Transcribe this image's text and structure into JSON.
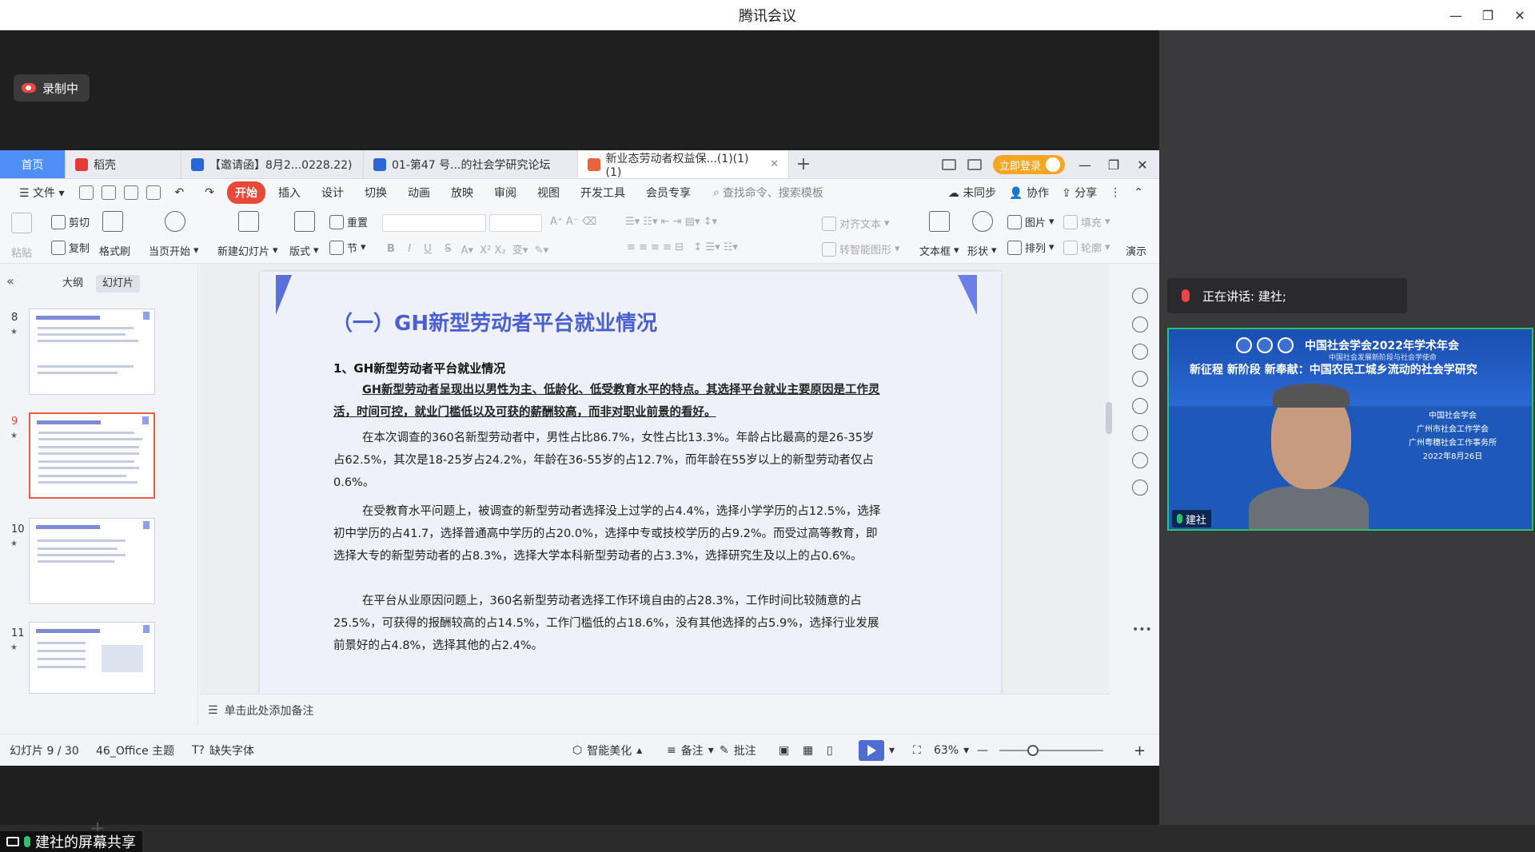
{
  "window": {
    "title": "腾讯会议",
    "controls": [
      "minimize",
      "restore",
      "close"
    ]
  },
  "recording": {
    "label": "录制中"
  },
  "wps": {
    "tabs": [
      {
        "label": "首页",
        "icon": ""
      },
      {
        "label": "稻壳",
        "icon": "wps-icon"
      },
      {
        "label": "【邀请函】8月2...0228.22)",
        "icon": "word-icon"
      },
      {
        "label": "01-第47 号...的社会学研究论坛",
        "icon": "word-icon"
      },
      {
        "label": "新业态劳动者权益保...(1)(1)(1)",
        "icon": "ppt-icon"
      }
    ],
    "login_label": "立即登录",
    "menu": {
      "file": "文件",
      "items": [
        "开始",
        "插入",
        "设计",
        "切换",
        "动画",
        "放映",
        "审阅",
        "视图",
        "开发工具",
        "会员专享"
      ],
      "search": "查找命令、搜索模板",
      "right": [
        "未同步",
        "协作",
        "分享"
      ]
    },
    "ribbon": {
      "paste": "粘贴",
      "cut": "剪切",
      "copy": "复制",
      "format_painter": "格式刷",
      "start_current": "当页开始",
      "new_slide": "新建幻灯片",
      "layout": "版式",
      "reset": "重置",
      "section": "节",
      "align_text": "对齐文本",
      "convert_smartart": "转智能图形",
      "textbox": "文本框",
      "shape": "形状",
      "image": "图片",
      "fill": "填充",
      "arrange": "排列",
      "outline": "轮廓",
      "present": "演示"
    },
    "panel": {
      "tabs": [
        "大纲",
        "幻灯片"
      ],
      "thumbnails": [
        {
          "num": "8",
          "selected": false
        },
        {
          "num": "9",
          "selected": true
        },
        {
          "num": "10",
          "selected": false
        },
        {
          "num": "11",
          "selected": false
        }
      ]
    },
    "slide": {
      "title": "（一）GH新型劳动者平台就业情况",
      "subhead": "1、GH新型劳动者平台就业情况",
      "key_text": "GH新型劳动者呈现出以男性为主、低龄化、低受教育水平的特点。其选择平台就业主要原因是工作灵活，时间可控，就业门槛低以及可获的薪酬较高，而非对职业前景的看好。",
      "p1": "在本次调查的360名新型劳动者中，男性占比86.7%，女性占比13.3%。年龄占比最高的是26-35岁占62.5%，其次是18-25岁占24.2%，年龄在36-55岁的占12.7%，而年龄在55岁以上的新型劳动者仅占0.6%。",
      "p2": "在受教育水平问题上，被调查的新型劳动者选择没上过学的占4.4%，选择小学学历的占12.5%，选择初中学历的占41.7，选择普通高中学历的占20.0%，选择中专或技校学历的占9.2%。而受过高等教育，即选择大专的新型劳动者的占8.3%，选择大学本科新型劳动者的占3.3%，选择研究生及以上的占0.6%。",
      "p3": "在平台从业原因问题上，360名新型劳动者选择工作环境自由的占28.3%，工作时间比较随意的占25.5%，可获得的报酬较高的占14.5%，工作门槛低的占18.6%，没有其他选择的占5.9%，选择行业发展前景好的占4.8%，选择其他的占2.4%。"
    },
    "notes_placeholder": "单击此处添加备注",
    "status": {
      "slide_pos": "幻灯片 9 / 30",
      "theme": "46_Office 主题",
      "missing_font": "缺失字体",
      "smart_beautify": "智能美化",
      "notes": "备注",
      "comment": "批注",
      "zoom": "63%",
      "zoom_fraction": 0.3
    }
  },
  "meeting": {
    "speaker_prefix": "正在讲话: ",
    "speaker_name": "建社;",
    "video": {
      "banner_title": "中国社会学会2022年学术年会",
      "banner_sub": "中国社会发展新阶段与社会学使命",
      "banner_line": "新征程 新阶段 新奉献：中国农民工城乡流动的社会学研究",
      "orgs": [
        "中国社会学会",
        "广州市社会工作学会",
        "广州粤穗社会工作事务所",
        "2022年8月26日"
      ],
      "name": "建社"
    },
    "share_label": "建社的屏幕共享"
  }
}
